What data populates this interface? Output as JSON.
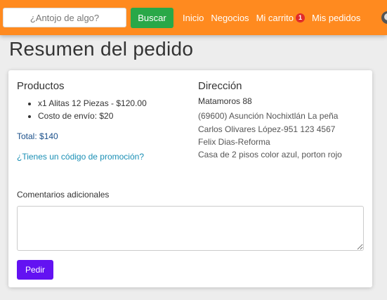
{
  "navbar": {
    "search": {
      "placeholder": "¿Antojo de algo?",
      "value": ""
    },
    "search_button_label": "Buscar",
    "links": {
      "home": "Inicio",
      "businesses": "Negocios",
      "cart": "Mi carrito",
      "cart_count": "1",
      "orders": "Mis pedidos"
    },
    "avatar_icon": "user-avatar-icon"
  },
  "page": {
    "title": "Resumen del pedido"
  },
  "products": {
    "heading": "Productos",
    "items": [
      "x1 Alitas 12 Piezas - $120.00",
      "Costo de envío: $20"
    ],
    "total": "Total: $140",
    "promo_link": "¿Tienes un código de promoción?"
  },
  "address": {
    "heading": "Dirección",
    "street": "Matamoros 88",
    "lines": [
      "(69600) Asunción Nochixtlán La peña",
      "Carlos Olivares López-951 123 4567",
      "Felix Dias-Reforma",
      "Casa de 2 pisos color azul, porton rojo"
    ]
  },
  "comments": {
    "label": "Comentarios adicionales",
    "value": ""
  },
  "order_button_label": "Pedir",
  "colors": {
    "navbar": "#ff8a1f",
    "search_button": "#29a848",
    "order_button": "#6312f2",
    "badge": "#e02b2b",
    "link": "#1a8fb5"
  }
}
